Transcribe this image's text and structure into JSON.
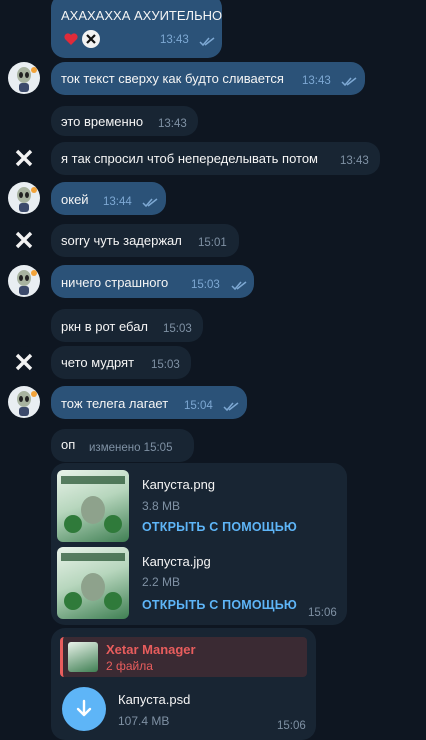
{
  "messages": [
    {
      "text": "АХАХАХХА АХУИТЕЛЬНО",
      "time": "13:43"
    },
    {
      "text": "ток текст сверху как будто сливается",
      "time": "13:43"
    },
    {
      "text": "это временно",
      "time": "13:43"
    },
    {
      "text": "я так спросил чтоб непеределывать потом",
      "time": "13:43"
    },
    {
      "text": "окей",
      "time": "13:44"
    },
    {
      "text": "sorry чуть задержал",
      "time": "15:01"
    },
    {
      "text": "ничего страшного",
      "time": "15:03"
    },
    {
      "text": "ркн в рот ебал",
      "time": "15:03"
    },
    {
      "text": "чето мудрят",
      "time": "15:03"
    },
    {
      "text": "тож телега лагает",
      "time": "15:04"
    },
    {
      "text": "оп",
      "time": "изменено 15:05"
    }
  ],
  "files_group": {
    "files": [
      {
        "name": "Капуста.png",
        "size": "3.8 MB",
        "action": "ОТКРЫТЬ С ПОМОЩЬЮ"
      },
      {
        "name": "Капуста.jpg",
        "size": "2.2 MB",
        "action": "ОТКРЫТЬ С ПОМОЩЬЮ"
      }
    ],
    "time": "15:06"
  },
  "forward": {
    "reply_name": "Xetar Manager",
    "reply_sub": "2 файла",
    "file_name": "Капуста.psd",
    "file_size": "107.4 MB",
    "time": "15:06"
  },
  "colors": {
    "out": "#2b5278",
    "in": "#182533",
    "accent": "#5eb5f7",
    "reply": "#e85d5d"
  },
  "icons": {
    "reaction_heart": "heart-icon",
    "reaction_avatar": "x-avatar-icon",
    "ticks": "double-check-icon",
    "download": "download-arrow-icon"
  }
}
